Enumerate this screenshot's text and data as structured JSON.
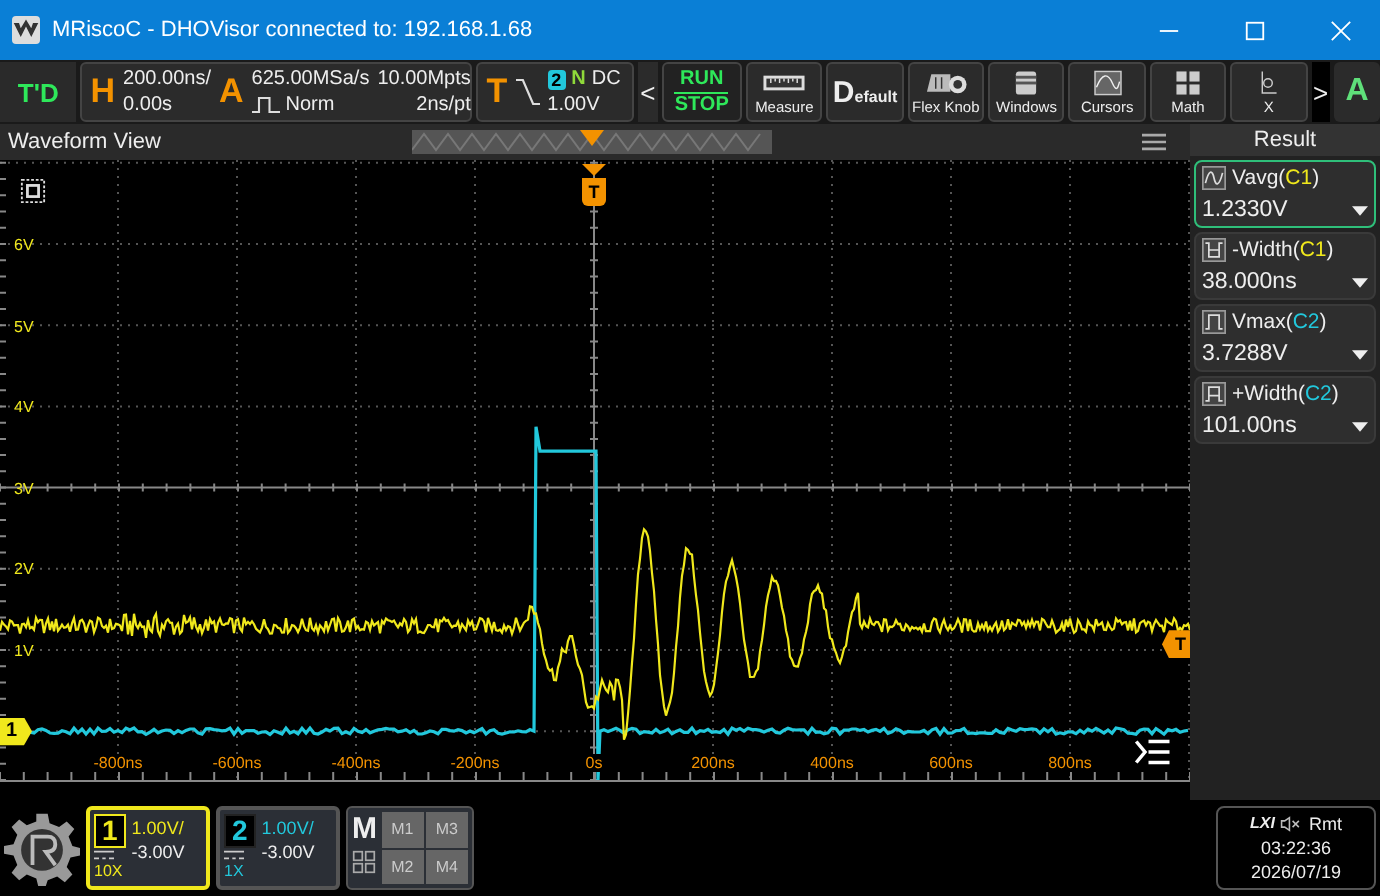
{
  "window": {
    "title": "MRiscoC - DHOVisor connected to: 192.168.1.68"
  },
  "toolbar": {
    "logo": "T'D",
    "horizontal": {
      "letter": "H",
      "timebase": "200.00ns/",
      "offset": "0.00s"
    },
    "acquire": {
      "letter": "A",
      "sample_rate": "625.00MSa/s",
      "mode": "Norm",
      "depth": "10.00Mpts",
      "resolution": "2ns/pt"
    },
    "trigger": {
      "letter": "T",
      "source": "2",
      "sweep": "N",
      "coupling": "DC",
      "level": "1.00V"
    },
    "scroll_left": "<",
    "run_stop": {
      "run": "RUN",
      "stop": "STOP"
    },
    "buttons": [
      {
        "kind": "measure",
        "label": "Measure"
      },
      {
        "kind": "default",
        "initial": "D",
        "label": "efault"
      },
      {
        "kind": "knob",
        "label": "Flex Knob"
      },
      {
        "kind": "windows",
        "label": "Windows"
      },
      {
        "kind": "cursors",
        "label": "Cursors"
      },
      {
        "kind": "math",
        "label": "Math"
      },
      {
        "kind": "partial",
        "label": "X"
      }
    ],
    "scroll_right": ">",
    "auto": "A"
  },
  "waveform_view": {
    "title": "Waveform View",
    "trigger_marker": "T",
    "level_marker": "T",
    "channel_marker": "1",
    "y_labels": [
      "6V",
      "5V",
      "4V",
      "3V",
      "2V",
      "1V"
    ],
    "x_labels": [
      "-800ns",
      "-600ns",
      "-400ns",
      "-200ns",
      "0s",
      "200ns",
      "400ns",
      "600ns",
      "800ns"
    ]
  },
  "result": {
    "title": "Result",
    "items": [
      {
        "kind": "average",
        "prefix": "Vavg(",
        "source": "C1",
        "suffix": ")",
        "color": "#f0e81c",
        "value": "1.2330V",
        "selected": true
      },
      {
        "kind": "neg_width",
        "prefix": "-Width(",
        "source": "C1",
        "suffix": ")",
        "color": "#f0e81c",
        "value": "38.000ns",
        "selected": false
      },
      {
        "kind": "max",
        "prefix": "Vmax(",
        "source": "C2",
        "suffix": ")",
        "color": "#22c8dc",
        "value": "3.7288V",
        "selected": false
      },
      {
        "kind": "pos_width",
        "prefix": "+Width(",
        "source": "C2",
        "suffix": ")",
        "color": "#22c8dc",
        "value": "101.00ns",
        "selected": false
      }
    ]
  },
  "channels": [
    {
      "number": "1",
      "scale": "1.00V/",
      "offset": "-3.00V",
      "probe": "10X",
      "color": "#f0e81c",
      "selected": true
    },
    {
      "number": "2",
      "scale": "1.00V/",
      "offset": "-3.00V",
      "probe": "1X",
      "color": "#22c8dc",
      "selected": false
    }
  ],
  "math": {
    "letter": "M",
    "slots": [
      "M1",
      "M3",
      "M2",
      "M4"
    ]
  },
  "status": {
    "lxi": "LXI",
    "remote": "Rmt",
    "time": "03:22:36",
    "date": "2026/07/19"
  }
}
